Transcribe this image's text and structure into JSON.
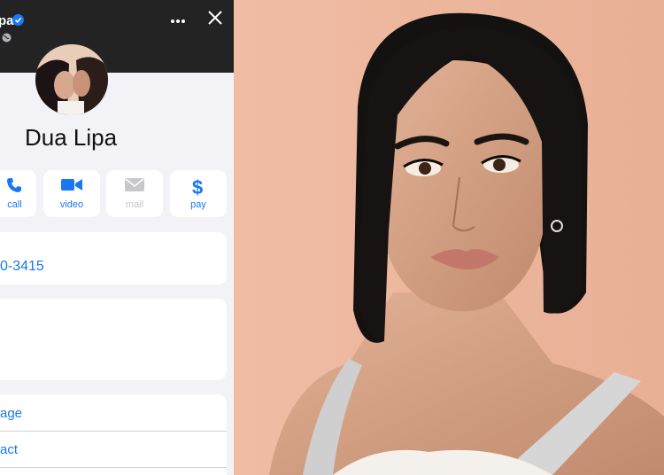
{
  "header": {
    "name_fragment": "pa",
    "more_icon": "more-horizontal-icon",
    "close_icon": "close-icon"
  },
  "contact": {
    "name": "Dua Lipa"
  },
  "actions": [
    {
      "label": "call",
      "icon": "phone-icon",
      "enabled": true
    },
    {
      "label": "video",
      "icon": "video-camera-icon",
      "enabled": true
    },
    {
      "label": "mail",
      "icon": "mail-icon",
      "enabled": false
    },
    {
      "label": "pay",
      "icon": "dollar-icon",
      "enabled": true
    }
  ],
  "phone_card": {
    "number_fragment": "0-3415"
  },
  "options": [
    {
      "label": "age"
    },
    {
      "label": "act"
    }
  ],
  "colors": {
    "accent": "#1877f2",
    "header_bg": "#232323",
    "panel_bg": "#f2f2f7",
    "photo_bg": "#ebb59c"
  }
}
